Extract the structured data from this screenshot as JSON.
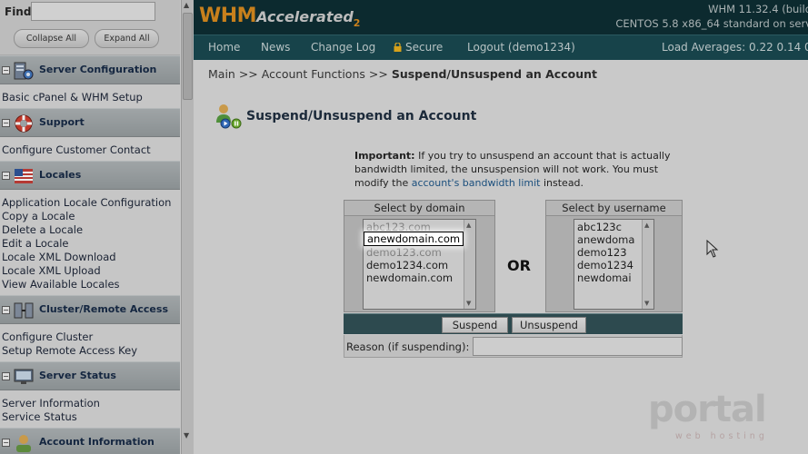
{
  "left": {
    "find_label": "Find",
    "find_value": "",
    "collapse_label": "Collapse All",
    "expand_label": "Expand All",
    "sections": [
      {
        "title": "Server Configuration",
        "icon": "server-config-icon",
        "links": [
          "Basic cPanel & WHM Setup"
        ]
      },
      {
        "title": "Support",
        "icon": "support-lifebuoy-icon",
        "links": [
          "Configure Customer Contact"
        ]
      },
      {
        "title": "Locales",
        "icon": "flag-icon",
        "links": [
          "Application Locale Configuration",
          "Copy a Locale",
          "Delete a Locale",
          "Edit a Locale",
          "Locale XML Download",
          "Locale XML Upload",
          "View Available Locales"
        ]
      },
      {
        "title": "Cluster/Remote Access",
        "icon": "cluster-icon",
        "links": [
          "Configure Cluster",
          "Setup Remote Access Key"
        ]
      },
      {
        "title": "Server Status",
        "icon": "monitor-icon",
        "links": [
          "Server Information",
          "Service Status"
        ]
      },
      {
        "title": "Account Information",
        "icon": "account-icon",
        "links": []
      }
    ]
  },
  "header": {
    "logo_main": "WHM",
    "logo_sub": "Accelerated",
    "logo_num": "2",
    "version_line1": "WHM 11.32.4 (build",
    "version_line2": "CENTOS 5.8 x86_64 standard on serv"
  },
  "nav": {
    "home": "Home",
    "news": "News",
    "changelog": "Change Log",
    "secure": "Secure",
    "logout": "Logout (demo1234)",
    "load_avg": "Load Averages: 0.22 0.14 0"
  },
  "breadcrumb": {
    "main": "Main",
    "sep": ">>",
    "section": "Account Functions",
    "current": "Suspend/Unsuspend an Account"
  },
  "page": {
    "title": "Suspend/Unsuspend an Account",
    "important_label": "Important:",
    "important_text": " If you try to unsuspend an account that is actually bandwidth limited, the unsuspension will not work. You must modify the ",
    "important_link": "account's bandwidth limit",
    "important_tail": " instead."
  },
  "domain_select": {
    "header": "Select by domain",
    "options": [
      "abc123.com",
      "anewdomain.com",
      "demo123.com",
      "demo1234.com",
      "newdomain.com"
    ],
    "selected": "anewdomain.com"
  },
  "or_label": "OR",
  "username_select": {
    "header": "Select by username",
    "options": [
      "abc123c",
      "anewdoma",
      "demo123",
      "demo1234",
      "newdomai"
    ]
  },
  "actions": {
    "suspend": "Suspend",
    "unsuspend": "Unsuspend",
    "reason_label": "Reason (if suspending):",
    "reason_value": ""
  },
  "watermark": {
    "main": "portal",
    "sub": "web hosting"
  }
}
